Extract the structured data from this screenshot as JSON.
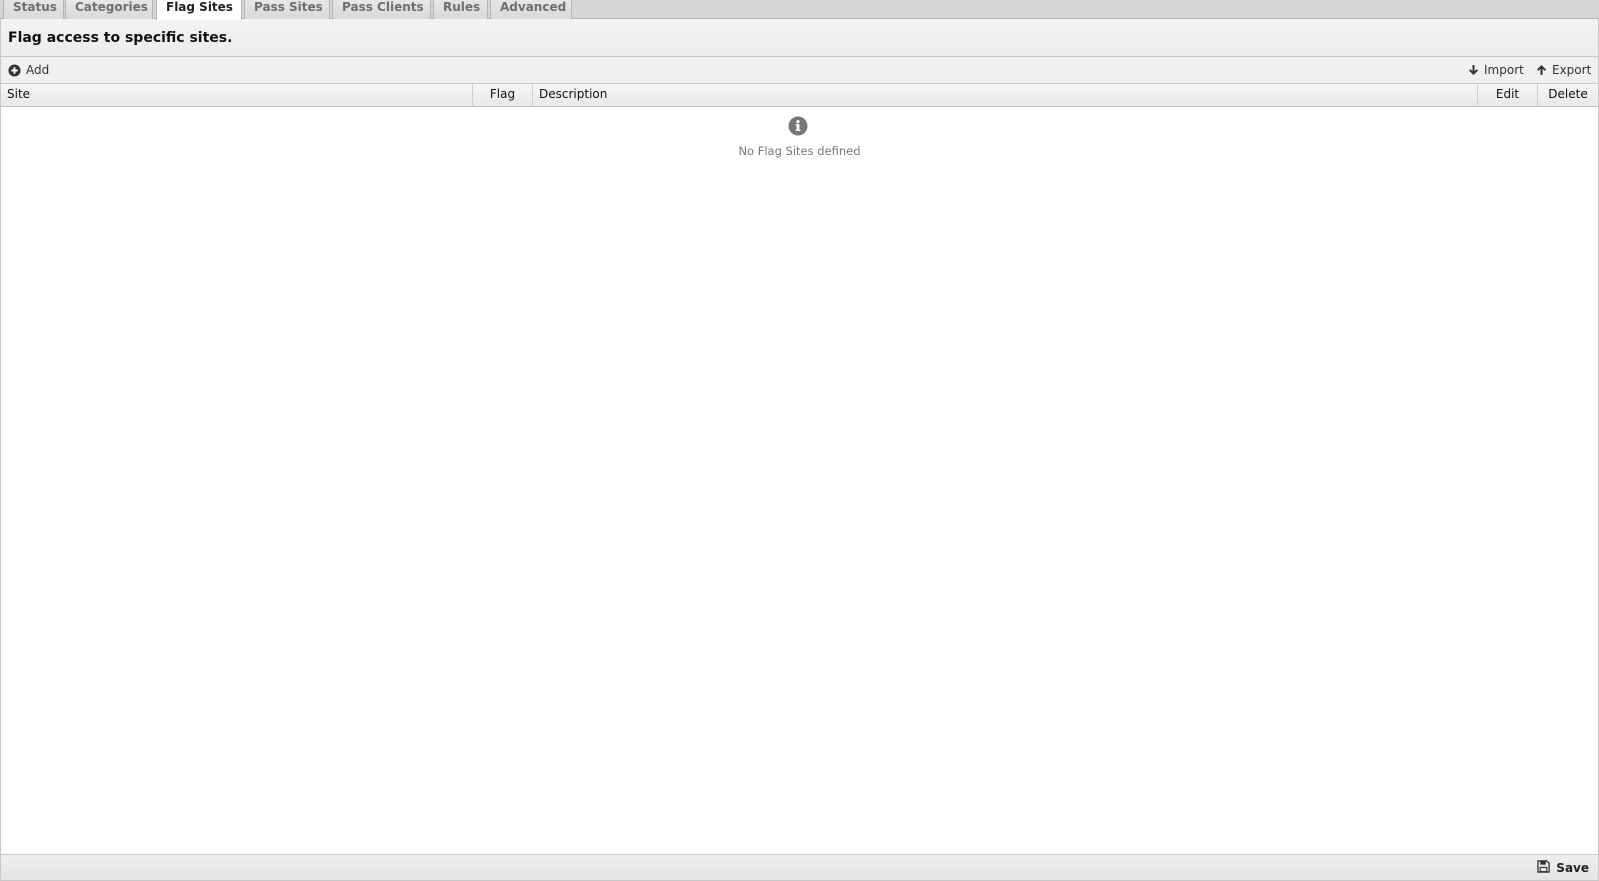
{
  "tabs": [
    {
      "label": "Status",
      "active": false
    },
    {
      "label": "Categories",
      "active": false
    },
    {
      "label": "Flag Sites",
      "active": true
    },
    {
      "label": "Pass Sites",
      "active": false
    },
    {
      "label": "Pass Clients",
      "active": false
    },
    {
      "label": "Rules",
      "active": false
    },
    {
      "label": "Advanced",
      "active": false
    }
  ],
  "header": {
    "title": "Flag access to specific sites."
  },
  "toolbar": {
    "add_label": "Add",
    "import_label": "Import",
    "export_label": "Export"
  },
  "grid": {
    "columns": [
      "Site",
      "Flag",
      "Description",
      "Edit",
      "Delete"
    ],
    "rows": [],
    "empty_message": "No Flag Sites defined"
  },
  "footer": {
    "save_label": "Save"
  },
  "icons": {
    "add": "plus-circle-icon",
    "import": "arrow-down-icon",
    "export": "arrow-up-icon",
    "empty": "info-icon",
    "save": "floppy-disk-icon"
  },
  "colors": {
    "tab_bar": "#d6d6d6",
    "header_bg": "#f0f0f0",
    "icon_gray": "#777777"
  }
}
